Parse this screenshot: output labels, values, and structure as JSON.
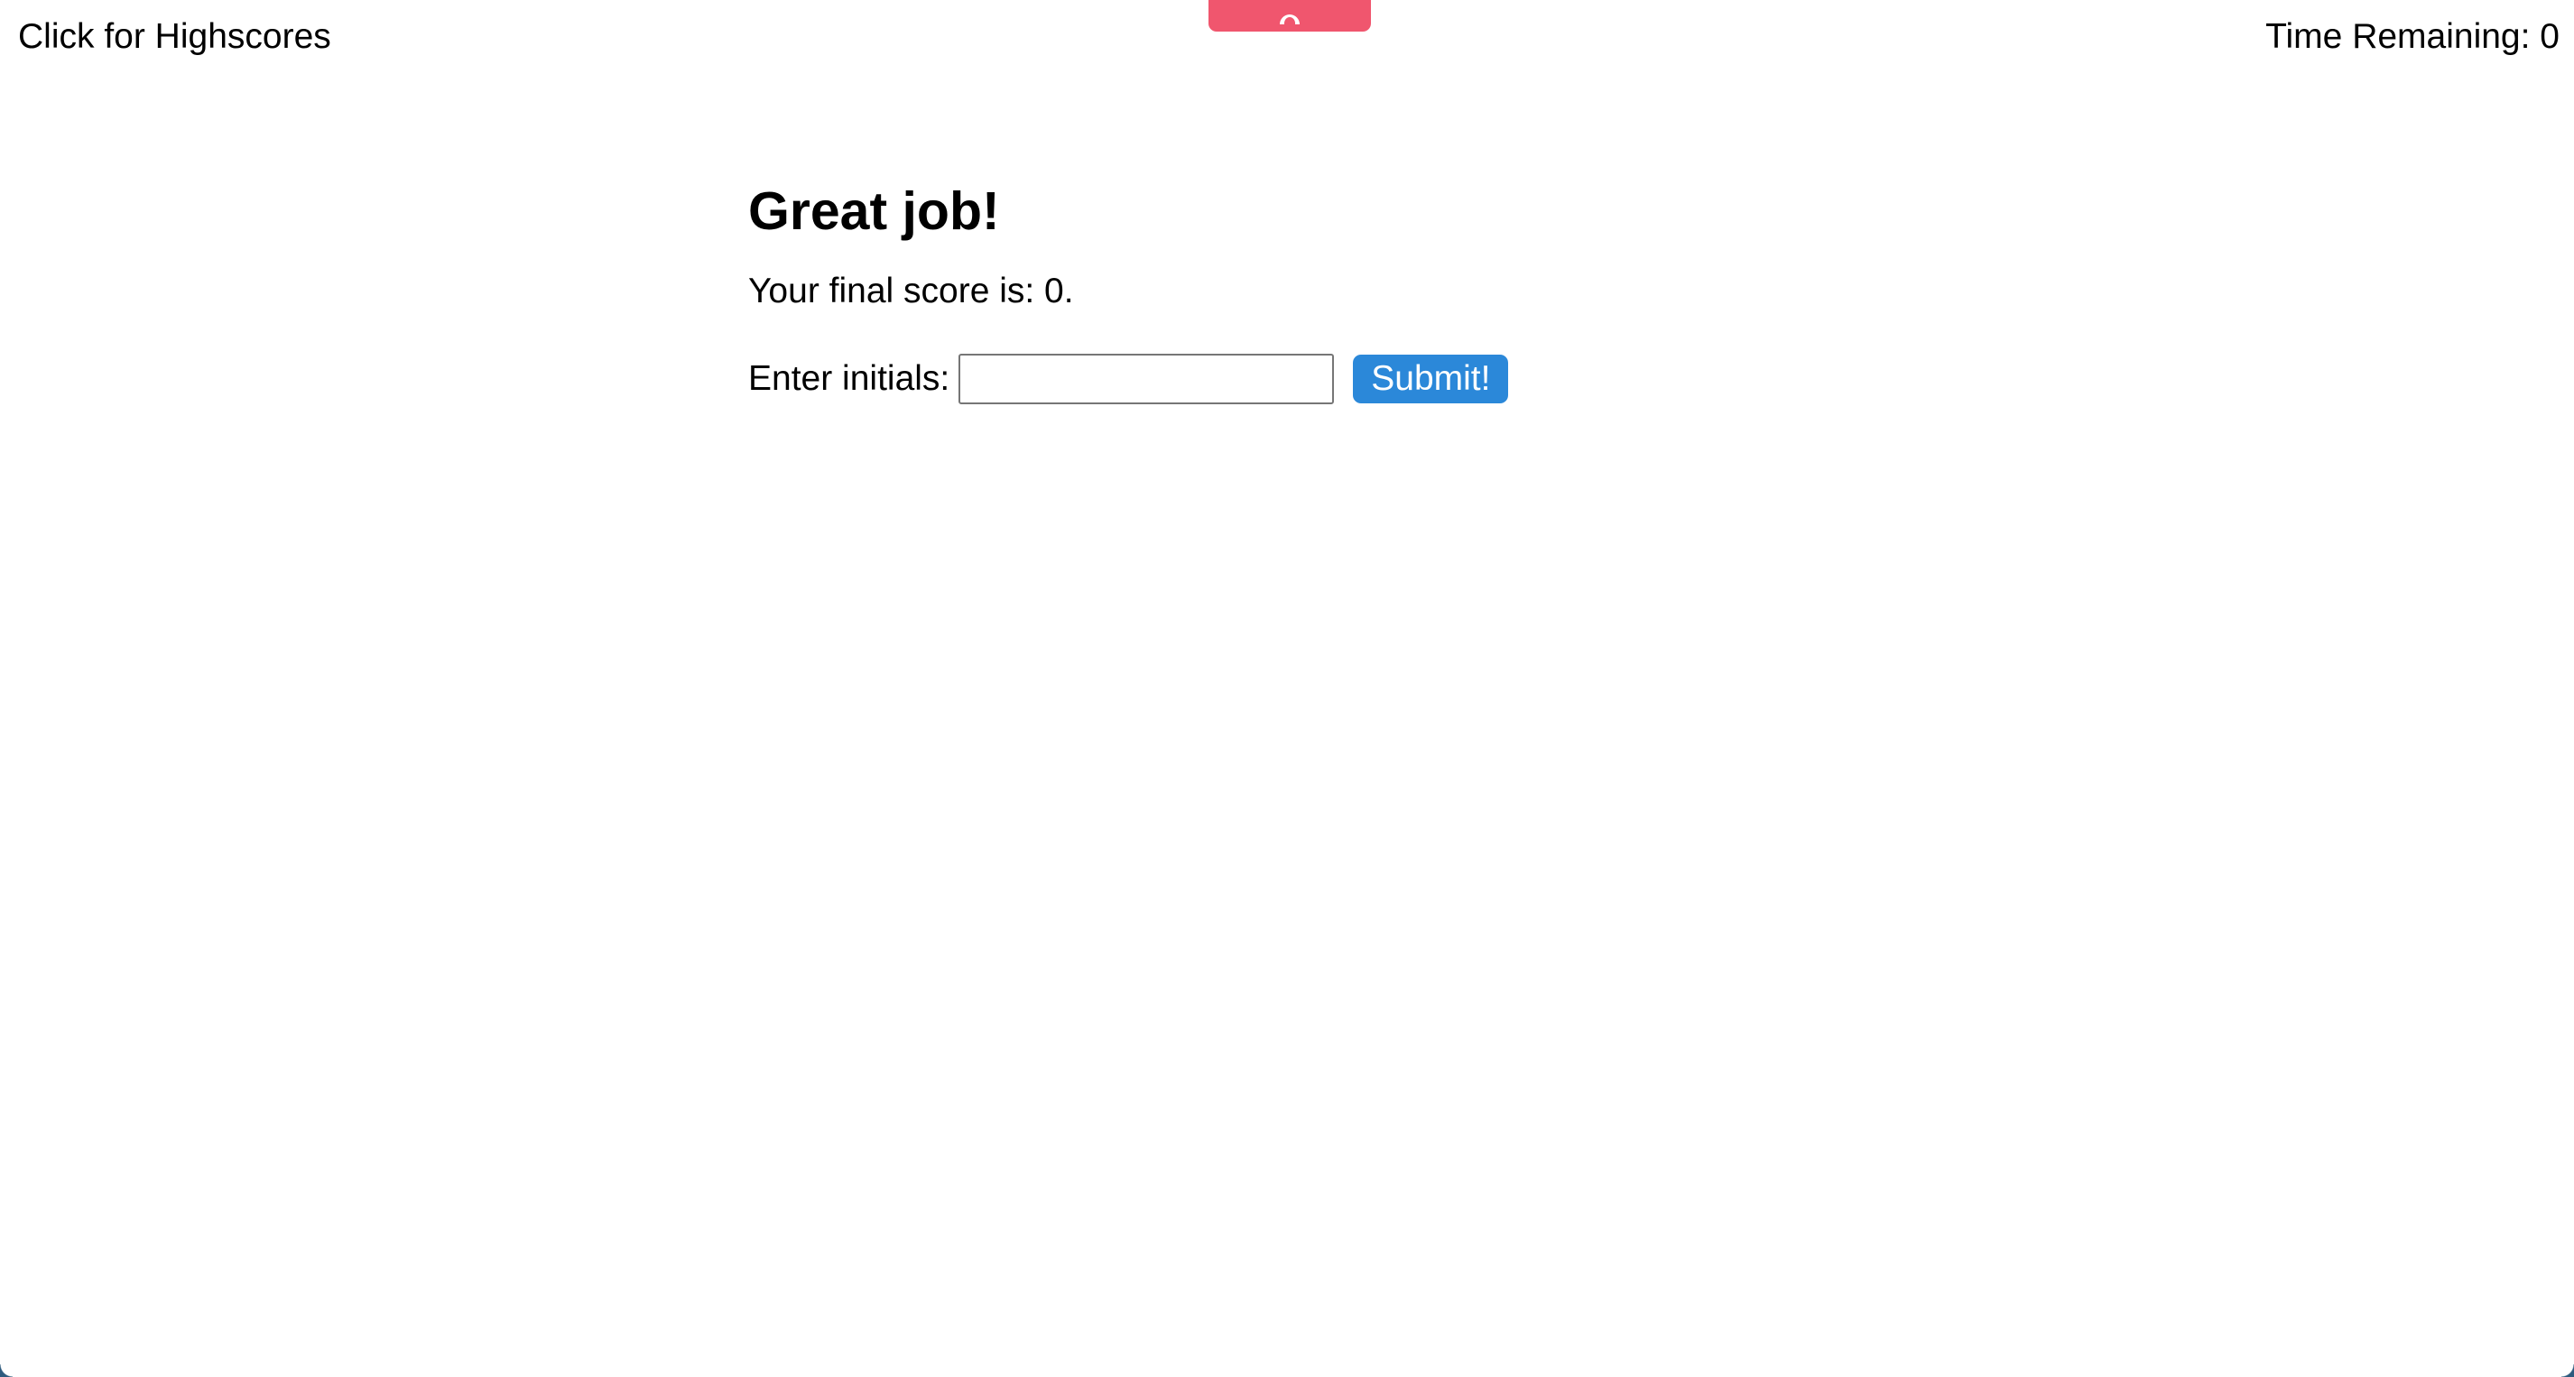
{
  "header": {
    "highscores_label": "Click for Highscores",
    "timer_label": "Time Remaining: 0"
  },
  "top_tab": {
    "icon": "pull-tab-icon",
    "color": "#F0566E"
  },
  "main": {
    "heading": "Great job!",
    "score_text": "Your final score is: 0.",
    "initials_label": "Enter initials:",
    "initials_value": "",
    "initials_placeholder": "",
    "submit_label": "Submit!"
  },
  "colors": {
    "accent": "#2B88D9",
    "tab": "#F0566E",
    "corner": "#2E5B7E"
  }
}
